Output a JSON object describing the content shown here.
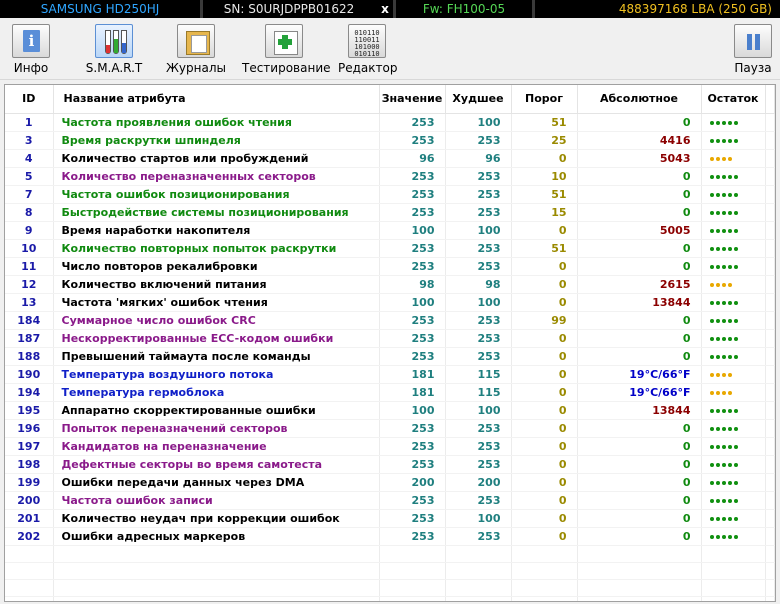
{
  "topbar": {
    "model": "SAMSUNG HD250HJ",
    "serial": "SN: S0URJDPPB01622",
    "close": "x",
    "firmware": "Fw: FH100-05",
    "capacity": "488397168 LBA (250 GB)"
  },
  "toolbar": {
    "info": "Инфо",
    "smart": "S.M.A.R.T",
    "logs": "Журналы",
    "tests": "Тестирование",
    "editor": "Редактор",
    "pause": "Пауза",
    "binary_lines": [
      "010110",
      "110011",
      "101000",
      "010110"
    ]
  },
  "columns": {
    "id": "ID",
    "name": "Название атрибута",
    "value": "Значение",
    "worst": "Худшее",
    "threshold": "Порог",
    "raw": "Абсолютное",
    "remaining": "Остаток"
  },
  "colors": {
    "ok": "#108a10",
    "warn": "#e8a800",
    "raw_nonzero": "#8b0000",
    "temp": "#0000c8"
  },
  "rows": [
    {
      "id": "1",
      "name": "Частота проявления ошибок чтения",
      "value": "253",
      "worst": "100",
      "threshold": "51",
      "raw": "0",
      "color": "green",
      "rawkind": "zero",
      "rating": 5,
      "state": "g"
    },
    {
      "id": "3",
      "name": "Время раскрутки шпинделя",
      "value": "253",
      "worst": "253",
      "threshold": "25",
      "raw": "4416",
      "color": "green",
      "rawkind": "nz",
      "rating": 5,
      "state": "g"
    },
    {
      "id": "4",
      "name": "Количество стартов или пробуждений",
      "value": "96",
      "worst": "96",
      "threshold": "0",
      "raw": "5043",
      "color": "black",
      "rawkind": "nz",
      "rating": 4,
      "state": "y"
    },
    {
      "id": "5",
      "name": "Количество переназначенных секторов",
      "value": "253",
      "worst": "253",
      "threshold": "10",
      "raw": "0",
      "color": "purple",
      "rawkind": "zero",
      "rating": 5,
      "state": "g"
    },
    {
      "id": "7",
      "name": "Частота ошибок позиционирования",
      "value": "253",
      "worst": "253",
      "threshold": "51",
      "raw": "0",
      "color": "green",
      "rawkind": "zero",
      "rating": 5,
      "state": "g"
    },
    {
      "id": "8",
      "name": "Быстродействие системы позиционирования",
      "value": "253",
      "worst": "253",
      "threshold": "15",
      "raw": "0",
      "color": "green",
      "rawkind": "zero",
      "rating": 5,
      "state": "g"
    },
    {
      "id": "9",
      "name": "Время наработки накопителя",
      "value": "100",
      "worst": "100",
      "threshold": "0",
      "raw": "5005",
      "color": "black",
      "rawkind": "nz",
      "rating": 5,
      "state": "g"
    },
    {
      "id": "10",
      "name": "Количество повторных попыток раскрутки",
      "value": "253",
      "worst": "253",
      "threshold": "51",
      "raw": "0",
      "color": "green",
      "rawkind": "zero",
      "rating": 5,
      "state": "g"
    },
    {
      "id": "11",
      "name": "Число повторов рекалибровки",
      "value": "253",
      "worst": "253",
      "threshold": "0",
      "raw": "0",
      "color": "black",
      "rawkind": "zero",
      "rating": 5,
      "state": "g"
    },
    {
      "id": "12",
      "name": "Количество включений питания",
      "value": "98",
      "worst": "98",
      "threshold": "0",
      "raw": "2615",
      "color": "black",
      "rawkind": "nz",
      "rating": 4,
      "state": "y"
    },
    {
      "id": "13",
      "name": "Частота 'мягких' ошибок чтения",
      "value": "100",
      "worst": "100",
      "threshold": "0",
      "raw": "13844",
      "color": "black",
      "rawkind": "nz",
      "rating": 5,
      "state": "g"
    },
    {
      "id": "184",
      "name": "Суммарное число ошибок CRC",
      "value": "253",
      "worst": "253",
      "threshold": "99",
      "raw": "0",
      "color": "purple",
      "rawkind": "zero",
      "rating": 5,
      "state": "g"
    },
    {
      "id": "187",
      "name": "Нескорректированные ECC-кодом ошибки",
      "value": "253",
      "worst": "253",
      "threshold": "0",
      "raw": "0",
      "color": "purple",
      "rawkind": "zero",
      "rating": 5,
      "state": "g"
    },
    {
      "id": "188",
      "name": "Превышений таймаута после команды",
      "value": "253",
      "worst": "253",
      "threshold": "0",
      "raw": "0",
      "color": "black",
      "rawkind": "zero",
      "rating": 5,
      "state": "g"
    },
    {
      "id": "190",
      "name": "Температура воздушного потока",
      "value": "181",
      "worst": "115",
      "threshold": "0",
      "raw": "19°C/66°F",
      "color": "blue",
      "rawkind": "temp",
      "rating": 4,
      "state": "y"
    },
    {
      "id": "194",
      "name": "Температура гермоблока",
      "value": "181",
      "worst": "115",
      "threshold": "0",
      "raw": "19°C/66°F",
      "color": "blue",
      "rawkind": "temp",
      "rating": 4,
      "state": "y"
    },
    {
      "id": "195",
      "name": "Аппаратно скорректированные ошибки",
      "value": "100",
      "worst": "100",
      "threshold": "0",
      "raw": "13844",
      "color": "black",
      "rawkind": "nz",
      "rating": 5,
      "state": "g"
    },
    {
      "id": "196",
      "name": "Попыток переназначений секторов",
      "value": "253",
      "worst": "253",
      "threshold": "0",
      "raw": "0",
      "color": "purple",
      "rawkind": "zero",
      "rating": 5,
      "state": "g"
    },
    {
      "id": "197",
      "name": "Кандидатов на переназначение",
      "value": "253",
      "worst": "253",
      "threshold": "0",
      "raw": "0",
      "color": "purple",
      "rawkind": "zero",
      "rating": 5,
      "state": "g"
    },
    {
      "id": "198",
      "name": "Дефектные секторы во время самотеста",
      "value": "253",
      "worst": "253",
      "threshold": "0",
      "raw": "0",
      "color": "purple",
      "rawkind": "zero",
      "rating": 5,
      "state": "g"
    },
    {
      "id": "199",
      "name": "Ошибки передачи данных через DMA",
      "value": "200",
      "worst": "200",
      "threshold": "0",
      "raw": "0",
      "color": "black",
      "rawkind": "zero",
      "rating": 5,
      "state": "g"
    },
    {
      "id": "200",
      "name": "Частота ошибок записи",
      "value": "253",
      "worst": "253",
      "threshold": "0",
      "raw": "0",
      "color": "purple",
      "rawkind": "zero",
      "rating": 5,
      "state": "g"
    },
    {
      "id": "201",
      "name": "Количество неудач при коррекции ошибок",
      "value": "253",
      "worst": "100",
      "threshold": "0",
      "raw": "0",
      "color": "black",
      "rawkind": "zero",
      "rating": 5,
      "state": "g"
    },
    {
      "id": "202",
      "name": "Ошибки адресных маркеров",
      "value": "253",
      "worst": "253",
      "threshold": "0",
      "raw": "0",
      "color": "black",
      "rawkind": "zero",
      "rating": 5,
      "state": "g"
    }
  ]
}
